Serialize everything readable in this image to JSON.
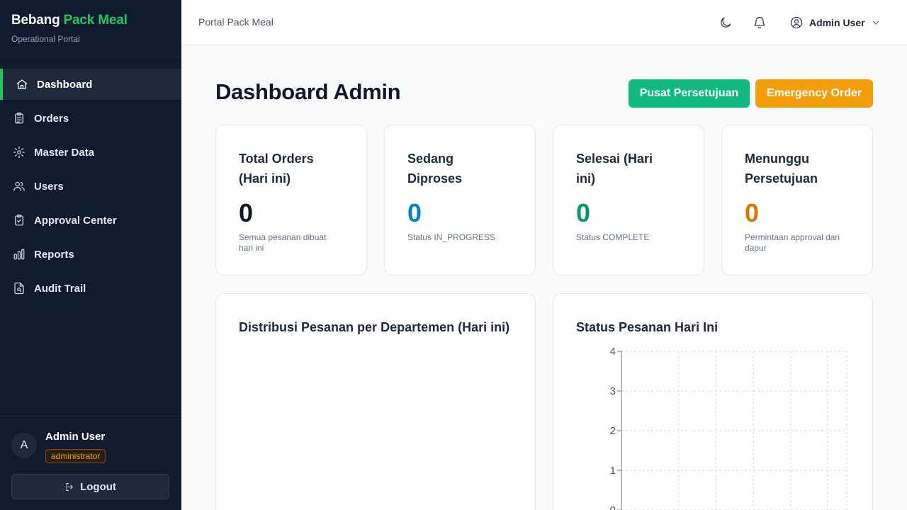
{
  "brand": {
    "name_part1": "Bebang",
    "name_part2": "Pack Meal",
    "subtitle": "Operational Portal"
  },
  "sidebar": {
    "items": [
      {
        "label": "Dashboard",
        "icon": "home-icon",
        "active": true
      },
      {
        "label": "Orders",
        "icon": "clipboard-icon",
        "active": false
      },
      {
        "label": "Master Data",
        "icon": "gear-icon",
        "active": false
      },
      {
        "label": "Users",
        "icon": "users-icon",
        "active": false
      },
      {
        "label": "Approval Center",
        "icon": "clipboard-check-icon",
        "active": false
      },
      {
        "label": "Reports",
        "icon": "bar-chart-icon",
        "active": false
      },
      {
        "label": "Audit Trail",
        "icon": "file-search-icon",
        "active": false
      }
    ],
    "user": {
      "initial": "A",
      "name": "Admin User",
      "role": "administrator"
    },
    "logout_label": "Logout"
  },
  "topbar": {
    "title": "Portal Pack Meal",
    "user_label": "Admin User"
  },
  "main": {
    "title": "Dashboard Admin",
    "approval_button": "Pusat Persetujuan",
    "emergency_button": "Emergency Order",
    "stats": [
      {
        "title": "Total Orders (Hari ini)",
        "value": "0",
        "note": "Semua pesanan dibuat hari ini",
        "color": "#0f172a"
      },
      {
        "title": "Sedang Diproses",
        "value": "0",
        "note": "Status IN_PROGRESS",
        "color": "#0284c7"
      },
      {
        "title": "Selesai (Hari ini)",
        "value": "0",
        "note": "Status COMPLETE",
        "color": "#059669"
      },
      {
        "title": "Menunggu Persetujuan",
        "value": "0",
        "note": "Permintaan approval dari dapur",
        "color": "#d97706"
      }
    ],
    "dept_panel_title": "Distribusi Pesanan per Departemen (Hari ini)",
    "status_panel_title": "Status Pesanan Hari Ini"
  },
  "chart_data": {
    "type": "bar",
    "title": "Status Pesanan Hari Ini",
    "categories": [],
    "values": [],
    "yticks": [
      "0",
      "1",
      "2",
      "3",
      "4"
    ],
    "ylim": [
      0,
      4
    ],
    "grid": true
  }
}
